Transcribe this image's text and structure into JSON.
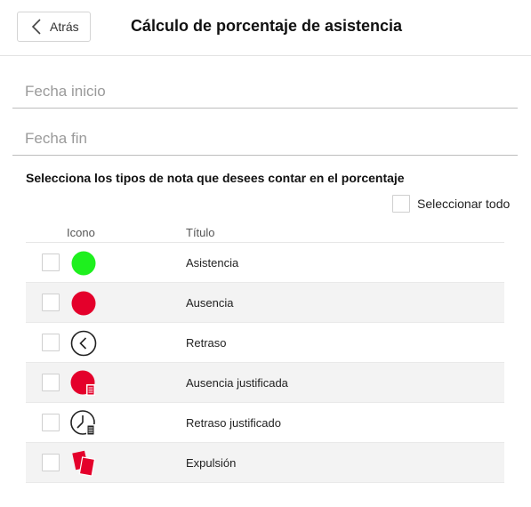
{
  "header": {
    "back_label": "Atrás",
    "title": "Cálculo de porcentaje de asistencia"
  },
  "form": {
    "start_date_placeholder": "Fecha inicio",
    "end_date_placeholder": "Fecha fin"
  },
  "instruction": "Selecciona los tipos de nota que desees contar en el porcentaje",
  "select_all_label": "Seleccionar todo",
  "table": {
    "columns": {
      "icon": "Icono",
      "title": "Título"
    },
    "rows": [
      {
        "title": "Asistencia",
        "icon": "green-circle-icon",
        "checked": false
      },
      {
        "title": "Ausencia",
        "icon": "red-circle-icon",
        "checked": false
      },
      {
        "title": "Retraso",
        "icon": "clock-icon",
        "checked": false
      },
      {
        "title": "Ausencia justificada",
        "icon": "red-circle-document-icon",
        "checked": false
      },
      {
        "title": "Retraso justificado",
        "icon": "clock-document-icon",
        "checked": false
      },
      {
        "title": "Expulsión",
        "icon": "red-card-icon",
        "checked": false
      }
    ]
  },
  "colors": {
    "present_green": "#1ef01e",
    "absent_red": "#e4002b",
    "row_alt_bg": "#f3f3f3",
    "divider": "#e3e3e3"
  }
}
